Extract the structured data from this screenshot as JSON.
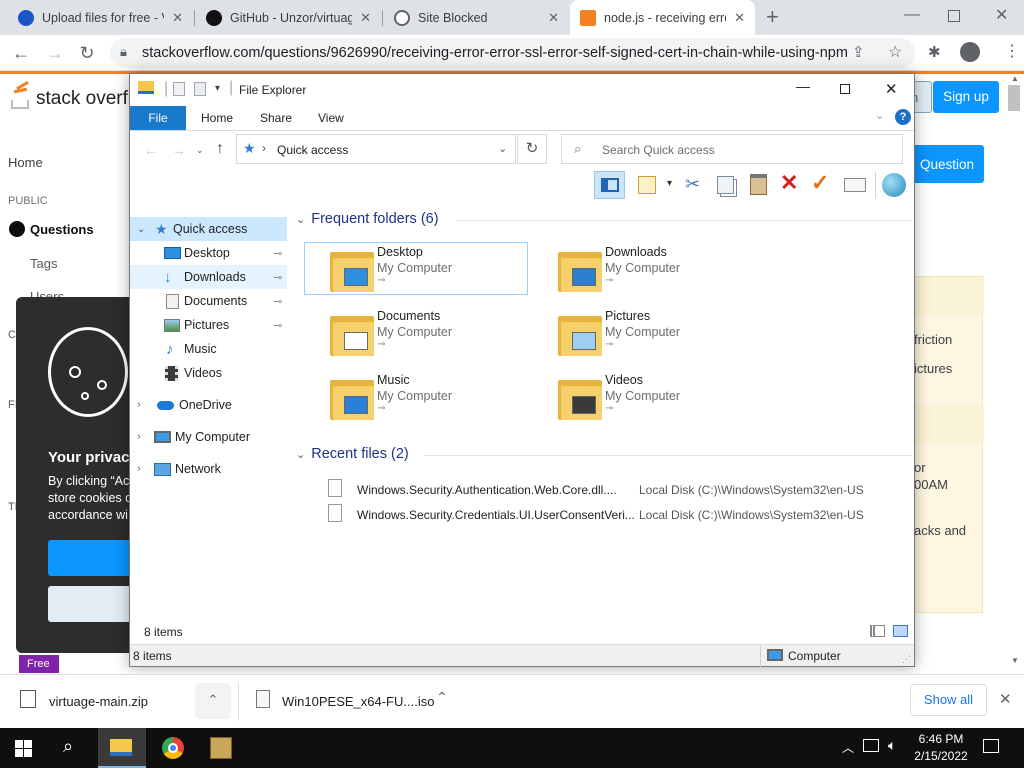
{
  "browser": {
    "tabs": [
      {
        "title": "Upload files for free - V",
        "active": false
      },
      {
        "title": "GitHub - Unzor/virtuag",
        "active": false
      },
      {
        "title": "Site Blocked",
        "active": false
      },
      {
        "title": "node.js - receiving erro",
        "active": true
      }
    ],
    "new_tab": "+",
    "url": "stackoverflow.com/questions/9626990/receiving-error-error-ssl-error-self-signed-cert-in-chain-while-using-npm"
  },
  "stackoverflow": {
    "logo": "stack overflow",
    "signup": "Sign up",
    "login": "n",
    "ask": "Question",
    "nav": {
      "home": "Home",
      "public": "PUBLIC",
      "questions": "Questions",
      "tags": "Tags",
      "users": "Users"
    },
    "side_letters": [
      "C",
      "FI",
      "TE"
    ],
    "right_snips": [
      "friction",
      "ictures",
      "or",
      "00AM",
      "acks and"
    ],
    "cookie": {
      "title": "Your privacy",
      "line1": "By clicking “Ac",
      "line2": "store cookies o",
      "line3": "accordance wi"
    },
    "free": "Free"
  },
  "explorer": {
    "title": "File Explorer",
    "ribbon": [
      "File",
      "Home",
      "Share",
      "View"
    ],
    "address": "Quick access",
    "search_placeholder": "Search Quick access",
    "nav_pane": {
      "quick_access": "Quick access",
      "pinned": [
        "Desktop",
        "Downloads",
        "Documents",
        "Pictures"
      ],
      "unpinned": [
        "Music",
        "Videos"
      ],
      "onedrive": "OneDrive",
      "my_computer": "My Computer",
      "network": "Network"
    },
    "frequent_header": "Frequent folders (6)",
    "folders": [
      {
        "name": "Desktop",
        "location": "My Computer"
      },
      {
        "name": "Downloads",
        "location": "My Computer"
      },
      {
        "name": "Documents",
        "location": "My Computer"
      },
      {
        "name": "Pictures",
        "location": "My Computer"
      },
      {
        "name": "Music",
        "location": "My Computer"
      },
      {
        "name": "Videos",
        "location": "My Computer"
      }
    ],
    "recent_header": "Recent files (2)",
    "recent": [
      {
        "name": "Windows.Security.Authentication.Web.Core.dll....",
        "path": "Local Disk (C:)\\Windows\\System32\\en-US"
      },
      {
        "name": "Windows.Security.Credentials.UI.UserConsentVeri...",
        "path": "Local Disk (C:)\\Windows\\System32\\en-US"
      }
    ],
    "items_count": "8 items",
    "status_count": "8 items",
    "status_location": "Computer"
  },
  "downloads": {
    "items": [
      "virtuage-main.zip",
      "Win10PESE_x64-FU....iso"
    ],
    "show_all": "Show all"
  },
  "taskbar": {
    "time": "6:46 PM",
    "date": "2/15/2022"
  }
}
